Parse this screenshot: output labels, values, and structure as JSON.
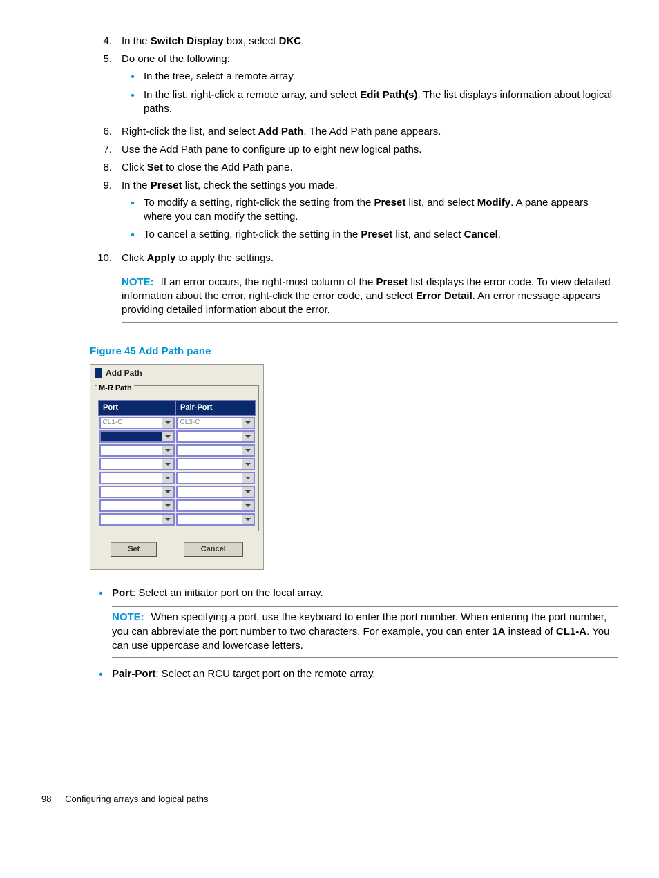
{
  "steps": {
    "s4": {
      "num": "4.",
      "pre": "In the ",
      "b1": "Switch Display",
      "mid": " box, select ",
      "b2": "DKC",
      "post": "."
    },
    "s5": {
      "num": "5.",
      "text": "Do one of the following:",
      "a": "In the tree, select a remote array.",
      "b_pre": "In the list, right-click a remote array, and select ",
      "b_b": "Edit Path(s)",
      "b_post": ". The list displays information about logical paths."
    },
    "s6": {
      "num": "6.",
      "pre": "Right-click the list, and select ",
      "b": "Add Path",
      "post": ". The Add Path pane appears."
    },
    "s7": {
      "num": "7.",
      "text": "Use the Add Path pane to configure up to eight new logical paths."
    },
    "s8": {
      "num": "8.",
      "pre": "Click ",
      "b": "Set",
      "post": " to close the Add Path pane."
    },
    "s9": {
      "num": "9.",
      "pre": "In the ",
      "b": "Preset",
      "post": " list, check the settings you made.",
      "a_pre": "To modify a setting, right-click the setting from the ",
      "a_b1": "Preset",
      "a_mid": " list, and select ",
      "a_b2": "Modify",
      "a_post": ". A pane appears where you can modify the setting.",
      "b_pre": "To cancel a setting, right-click the setting in the ",
      "b_b1": "Preset",
      "b_mid": " list, and select ",
      "b_b2": "Cancel",
      "b_post": "."
    },
    "s10": {
      "num": "10.",
      "pre": "Click ",
      "b": "Apply",
      "post": " to apply the settings."
    }
  },
  "note1": {
    "label": "NOTE:",
    "pre": "If an error occurs, the right-most column of the ",
    "b1": "Preset",
    "mid": " list displays the error code. To view detailed information about the error, right-click the error code, and select ",
    "b2": "Error Detail",
    "post": ". An error message appears providing detailed information about the error."
  },
  "figure": {
    "caption": "Figure 45 Add Path pane",
    "title": "Add Path",
    "fieldset": "M-R Path",
    "col_port": "Port",
    "col_pair": "Pair-Port",
    "row1": {
      "port": "CL1-C",
      "pair": "CL3-C"
    },
    "btn_set": "Set",
    "btn_cancel": "Cancel"
  },
  "desc_port": {
    "b": "Port",
    "text": ": Select an initiator port on the local array."
  },
  "note2": {
    "label": "NOTE:",
    "pre": "When specifying a port, use the keyboard to enter the port number. When entering the port number, you can abbreviate the port number to two characters. For example, you can enter ",
    "b1": "1A",
    "mid": " instead of ",
    "b2": "CL1-A",
    "post": ". You can use uppercase and lowercase letters."
  },
  "desc_pair": {
    "b": "Pair-Port",
    "text": ": Select an RCU target port on the remote array."
  },
  "footer": {
    "page": "98",
    "title": "Configuring arrays and logical paths"
  }
}
